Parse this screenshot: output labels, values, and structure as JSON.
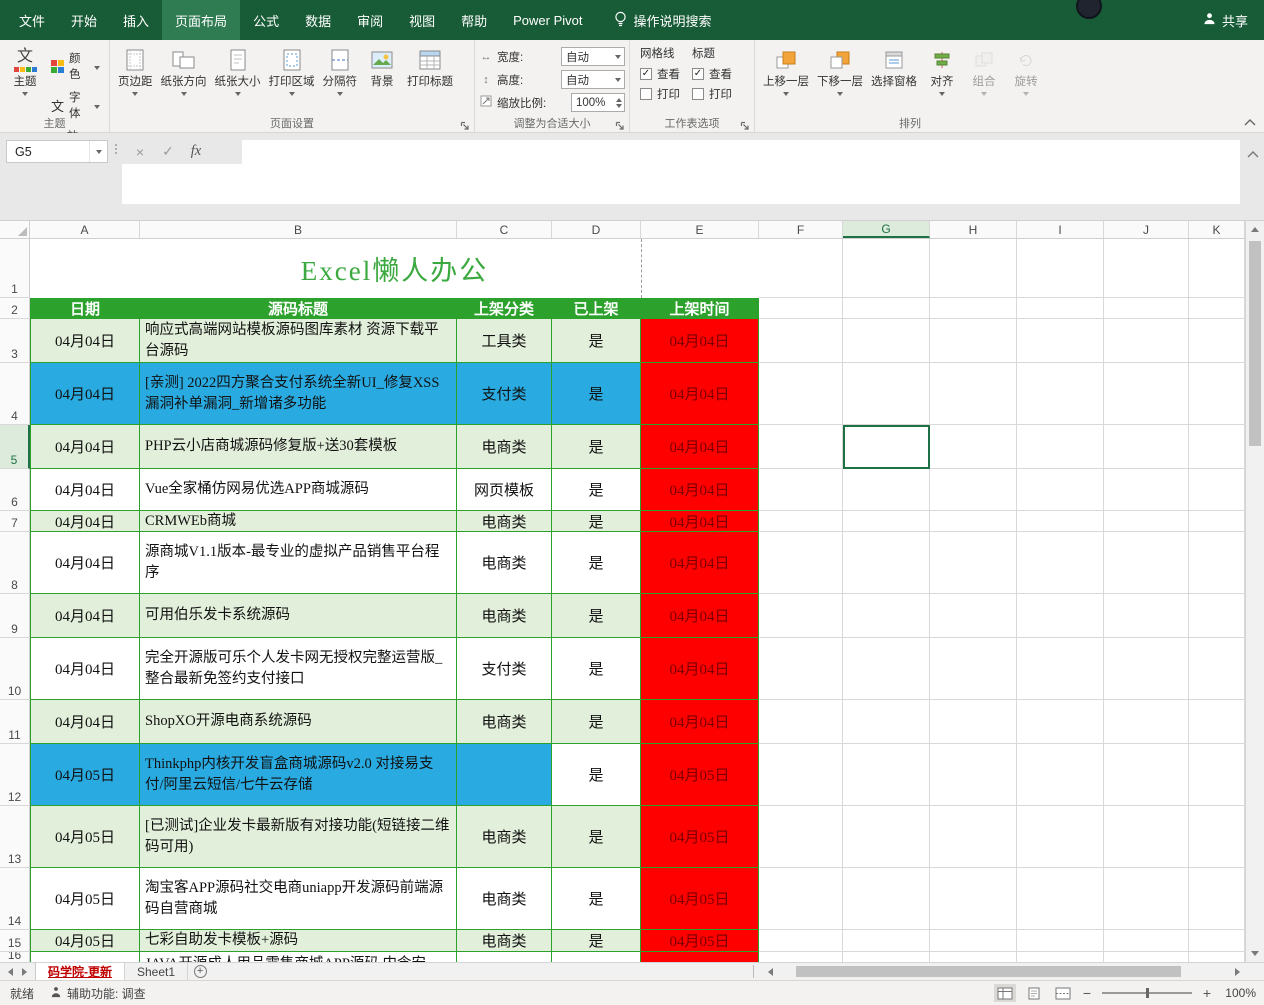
{
  "colors": {
    "header_green": "#2CA12C",
    "light_green": "#E2EFDA",
    "blue": "#29ABE2",
    "red": "#FE0000",
    "dark_red": "#7A0000",
    "title_green": "#3BA93F"
  },
  "titlebar": {
    "tabs": [
      {
        "label": "文件",
        "active": false
      },
      {
        "label": "开始",
        "active": false
      },
      {
        "label": "插入",
        "active": false
      },
      {
        "label": "页面布局",
        "active": true
      },
      {
        "label": "公式",
        "active": false
      },
      {
        "label": "数据",
        "active": false
      },
      {
        "label": "审阅",
        "active": false
      },
      {
        "label": "视图",
        "active": false
      },
      {
        "label": "帮助",
        "active": false
      },
      {
        "label": "Power Pivot",
        "active": false
      }
    ],
    "search_label": "操作说明搜索",
    "share_label": "共享"
  },
  "ribbon": {
    "themes": {
      "group_label": "主题",
      "big_button": "主题",
      "colors": "颜色",
      "fonts": "字体",
      "effects": "效果"
    },
    "page_setup": {
      "group_label": "页面设置",
      "buttons": [
        {
          "label": "页边距",
          "icon": "margins",
          "menu": true
        },
        {
          "label": "纸张方向",
          "icon": "orientation",
          "menu": true
        },
        {
          "label": "纸张大小",
          "icon": "paper-size",
          "menu": true
        },
        {
          "label": "打印区域",
          "icon": "print-area",
          "menu": true
        },
        {
          "label": "分隔符",
          "icon": "breaks",
          "menu": true
        },
        {
          "label": "背景",
          "icon": "background",
          "menu": false
        },
        {
          "label": "打印标题",
          "icon": "print-titles",
          "menu": false
        }
      ]
    },
    "scale": {
      "group_label": "调整为合适大小",
      "width_label": "宽度:",
      "width_value": "自动",
      "height_label": "高度:",
      "height_value": "自动",
      "scale_label": "缩放比例:",
      "scale_value": "100%"
    },
    "sheet_options": {
      "group_label": "工作表选项",
      "col1_title": "网格线",
      "col2_title": "标题",
      "view_label": "查看",
      "print_label": "打印"
    },
    "arrange": {
      "group_label": "排列",
      "buttons": [
        {
          "label": "上移一层",
          "icon": "bring-forward",
          "menu": true,
          "disabled": false
        },
        {
          "label": "下移一层",
          "icon": "send-backward",
          "menu": true,
          "disabled": false
        },
        {
          "label": "选择窗格",
          "icon": "selection-pane",
          "menu": false,
          "disabled": false
        },
        {
          "label": "对齐",
          "icon": "align",
          "menu": true,
          "disabled": false
        },
        {
          "label": "组合",
          "icon": "group",
          "menu": true,
          "disabled": true
        },
        {
          "label": "旋转",
          "icon": "rotate",
          "menu": true,
          "disabled": true
        }
      ]
    }
  },
  "formula_bar": {
    "name_box": "G5",
    "fx_label": "fx",
    "cancel_label": "×",
    "enter_label": "✓",
    "value": ""
  },
  "grid": {
    "selected_cell": "G5",
    "selected_col": "G",
    "selected_row": 5,
    "columns": [
      "A",
      "B",
      "C",
      "D",
      "E",
      "F",
      "G",
      "H",
      "I",
      "J",
      "K"
    ],
    "title": "Excel懒人办公",
    "headers": {
      "date": "日期",
      "title": "源码标题",
      "category": "上架分类",
      "listed": "已上架",
      "time": "上架时间"
    },
    "rows": [
      {
        "n": 3,
        "date": "04月04日",
        "title": "响应式高端网站模板源码图库素材 资源下载平台源码",
        "category": "工具类",
        "listed": "是",
        "time": "04月04日",
        "fill": "green"
      },
      {
        "n": 4,
        "date": "04月04日",
        "title": "[亲测] 2022四方聚合支付系统全新UI_修复XSS漏洞补单漏洞_新增诸多功能",
        "category": "支付类",
        "listed": "是",
        "time": "04月04日",
        "fill": "blue"
      },
      {
        "n": 5,
        "date": "04月04日",
        "title": "PHP云小店商城源码修复版+送30套模板",
        "category": "电商类",
        "listed": "是",
        "time": "04月04日",
        "fill": "green"
      },
      {
        "n": 6,
        "date": "04月04日",
        "title": "Vue全家桶仿网易优选APP商城源码",
        "category": "网页模板",
        "listed": "是",
        "time": "04月04日",
        "fill": "white"
      },
      {
        "n": 7,
        "date": "04月04日",
        "title": "CRMWEb商城",
        "category": "电商类",
        "listed": "是",
        "time": "04月04日",
        "fill": "green"
      },
      {
        "n": 8,
        "date": "04月04日",
        "title": "源商城V1.1版本-最专业的虚拟产品销售平台程序",
        "category": "电商类",
        "listed": "是",
        "time": "04月04日",
        "fill": "white"
      },
      {
        "n": 9,
        "date": "04月04日",
        "title": "可用伯乐发卡系统源码",
        "category": "电商类",
        "listed": "是",
        "time": "04月04日",
        "fill": "green"
      },
      {
        "n": 10,
        "date": "04月04日",
        "title": "完全开源版可乐个人发卡网无授权完整运营版_整合最新免签约支付接口",
        "category": "支付类",
        "listed": "是",
        "time": "04月04日",
        "fill": "white"
      },
      {
        "n": 11,
        "date": "04月04日",
        "title": "ShopXO开源电商系统源码",
        "category": "电商类",
        "listed": "是",
        "time": "04月04日",
        "fill": "green"
      },
      {
        "n": 12,
        "date": "04月05日",
        "title": "Thinkphp内核开发盲盒商城源码v2.0 对接易支付/阿里云短信/七牛云存储",
        "category": "",
        "listed": "是",
        "time": "04月05日",
        "fill": "blue",
        "d_fill": "white"
      },
      {
        "n": 13,
        "date": "04月05日",
        "title": "[已测试]企业发卡最新版有对接功能(短链接二维码可用)",
        "category": "电商类",
        "listed": "是",
        "time": "04月05日",
        "fill": "green"
      },
      {
        "n": 14,
        "date": "04月05日",
        "title": "淘宝客APP源码社交电商uniapp开发源码前端源码自营商城",
        "category": "电商类",
        "listed": "是",
        "time": "04月05日",
        "fill": "white"
      },
      {
        "n": 15,
        "date": "04月05日",
        "title": "七彩自助发卡模板+源码",
        "category": "电商类",
        "listed": "是",
        "time": "04月05日",
        "fill": "green"
      },
      {
        "n": 16,
        "date": "",
        "title": "JAVA开源成人用品零售商城APP源码 内含安",
        "category": "",
        "listed": "",
        "time": "",
        "fill": "white",
        "clipped": true
      }
    ]
  },
  "sheet_tabs": {
    "tabs": [
      {
        "label": "码学院-更新",
        "active": true
      },
      {
        "label": "Sheet1",
        "active": false
      }
    ],
    "add_label": "+"
  },
  "status_bar": {
    "ready": "就绪",
    "accessibility": "辅助功能: 调查",
    "zoom_value": "100%"
  }
}
